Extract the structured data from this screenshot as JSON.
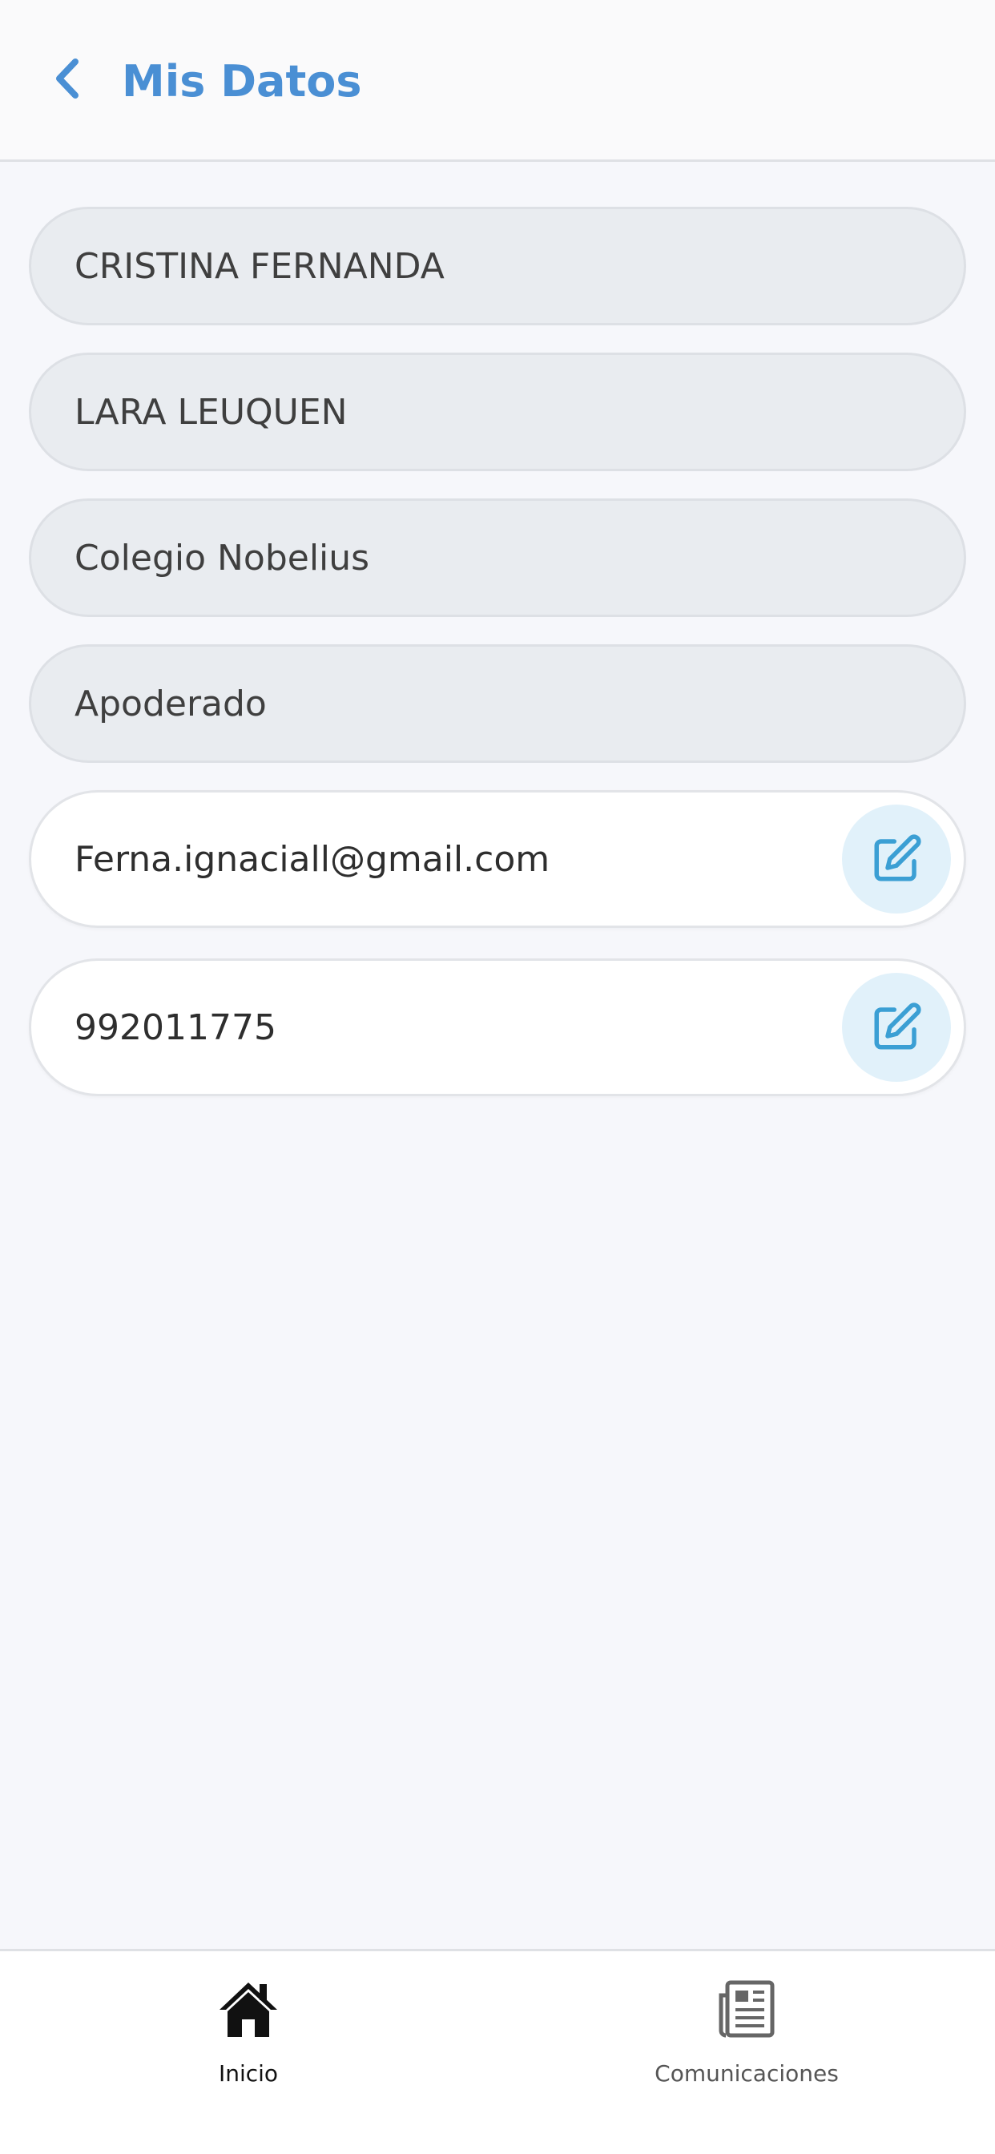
{
  "header": {
    "title": "Mis Datos",
    "back_icon": "chevron-left-icon"
  },
  "fields": {
    "first_name": "CRISTINA FERNANDA",
    "last_name": "LARA LEUQUEN",
    "school": "Colegio Nobelius",
    "role": "Apoderado",
    "email": "Ferna.ignaciall@gmail.com",
    "phone": "992011775"
  },
  "nav": {
    "home_label": "Inicio",
    "comms_label": "Comunicaciones"
  },
  "colors": {
    "accent": "#4a8fd4",
    "edit_icon": "#3b9fd4",
    "edit_bg": "#e1f1fa"
  }
}
